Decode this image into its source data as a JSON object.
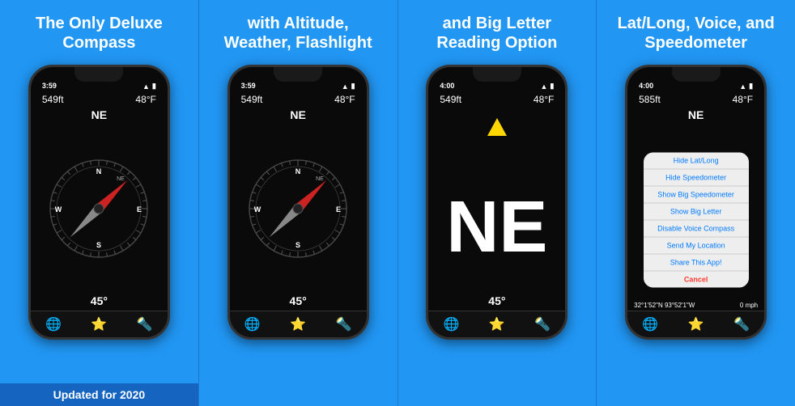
{
  "panels": [
    {
      "id": "panel1",
      "title": "The Only\nDeluxe Compass",
      "phone": {
        "time": "3:59",
        "altitude": "549ft",
        "temp": "48°F",
        "direction": "NE",
        "degree": "45°",
        "showCompass": true,
        "showBigLetter": false,
        "showMenu": false
      },
      "footer": "Updated for 2020",
      "showFooter": true
    },
    {
      "id": "panel2",
      "title": "with Altitude,\nWeather, Flashlight",
      "phone": {
        "time": "3:59",
        "altitude": "549ft",
        "temp": "48°F",
        "direction": "NE",
        "degree": "45°",
        "showCompass": true,
        "showBigLetter": false,
        "showMenu": false
      },
      "showFooter": false
    },
    {
      "id": "panel3",
      "title": "and Big Letter\nReading Option",
      "phone": {
        "time": "4:00",
        "altitude": "549ft",
        "temp": "48°F",
        "direction": "NE",
        "degree": "45°",
        "showCompass": false,
        "showBigLetter": true,
        "showMenu": false
      },
      "showFooter": false
    },
    {
      "id": "panel4",
      "title": "Lat/Long, Voice, and\nSpeedometer",
      "phone": {
        "time": "4:00",
        "altitude": "585ft",
        "temp": "48°F",
        "direction": "NE",
        "degree": "45°",
        "coords": "32°1'52\"N 93°52'1\"W",
        "speed": "0 mph",
        "showCompass": true,
        "showBigLetter": false,
        "showMenu": true
      },
      "showFooter": false
    }
  ],
  "menu": {
    "items": [
      "Hide Lat/Long",
      "Hide Speedometer",
      "Show Big Speedometer",
      "Show Big Letter",
      "Disable Voice Compass",
      "Send My Location",
      "Share This App!",
      "Cancel"
    ]
  },
  "toolbar": {
    "icons": [
      "🌐",
      "⭐",
      "🔦"
    ]
  }
}
